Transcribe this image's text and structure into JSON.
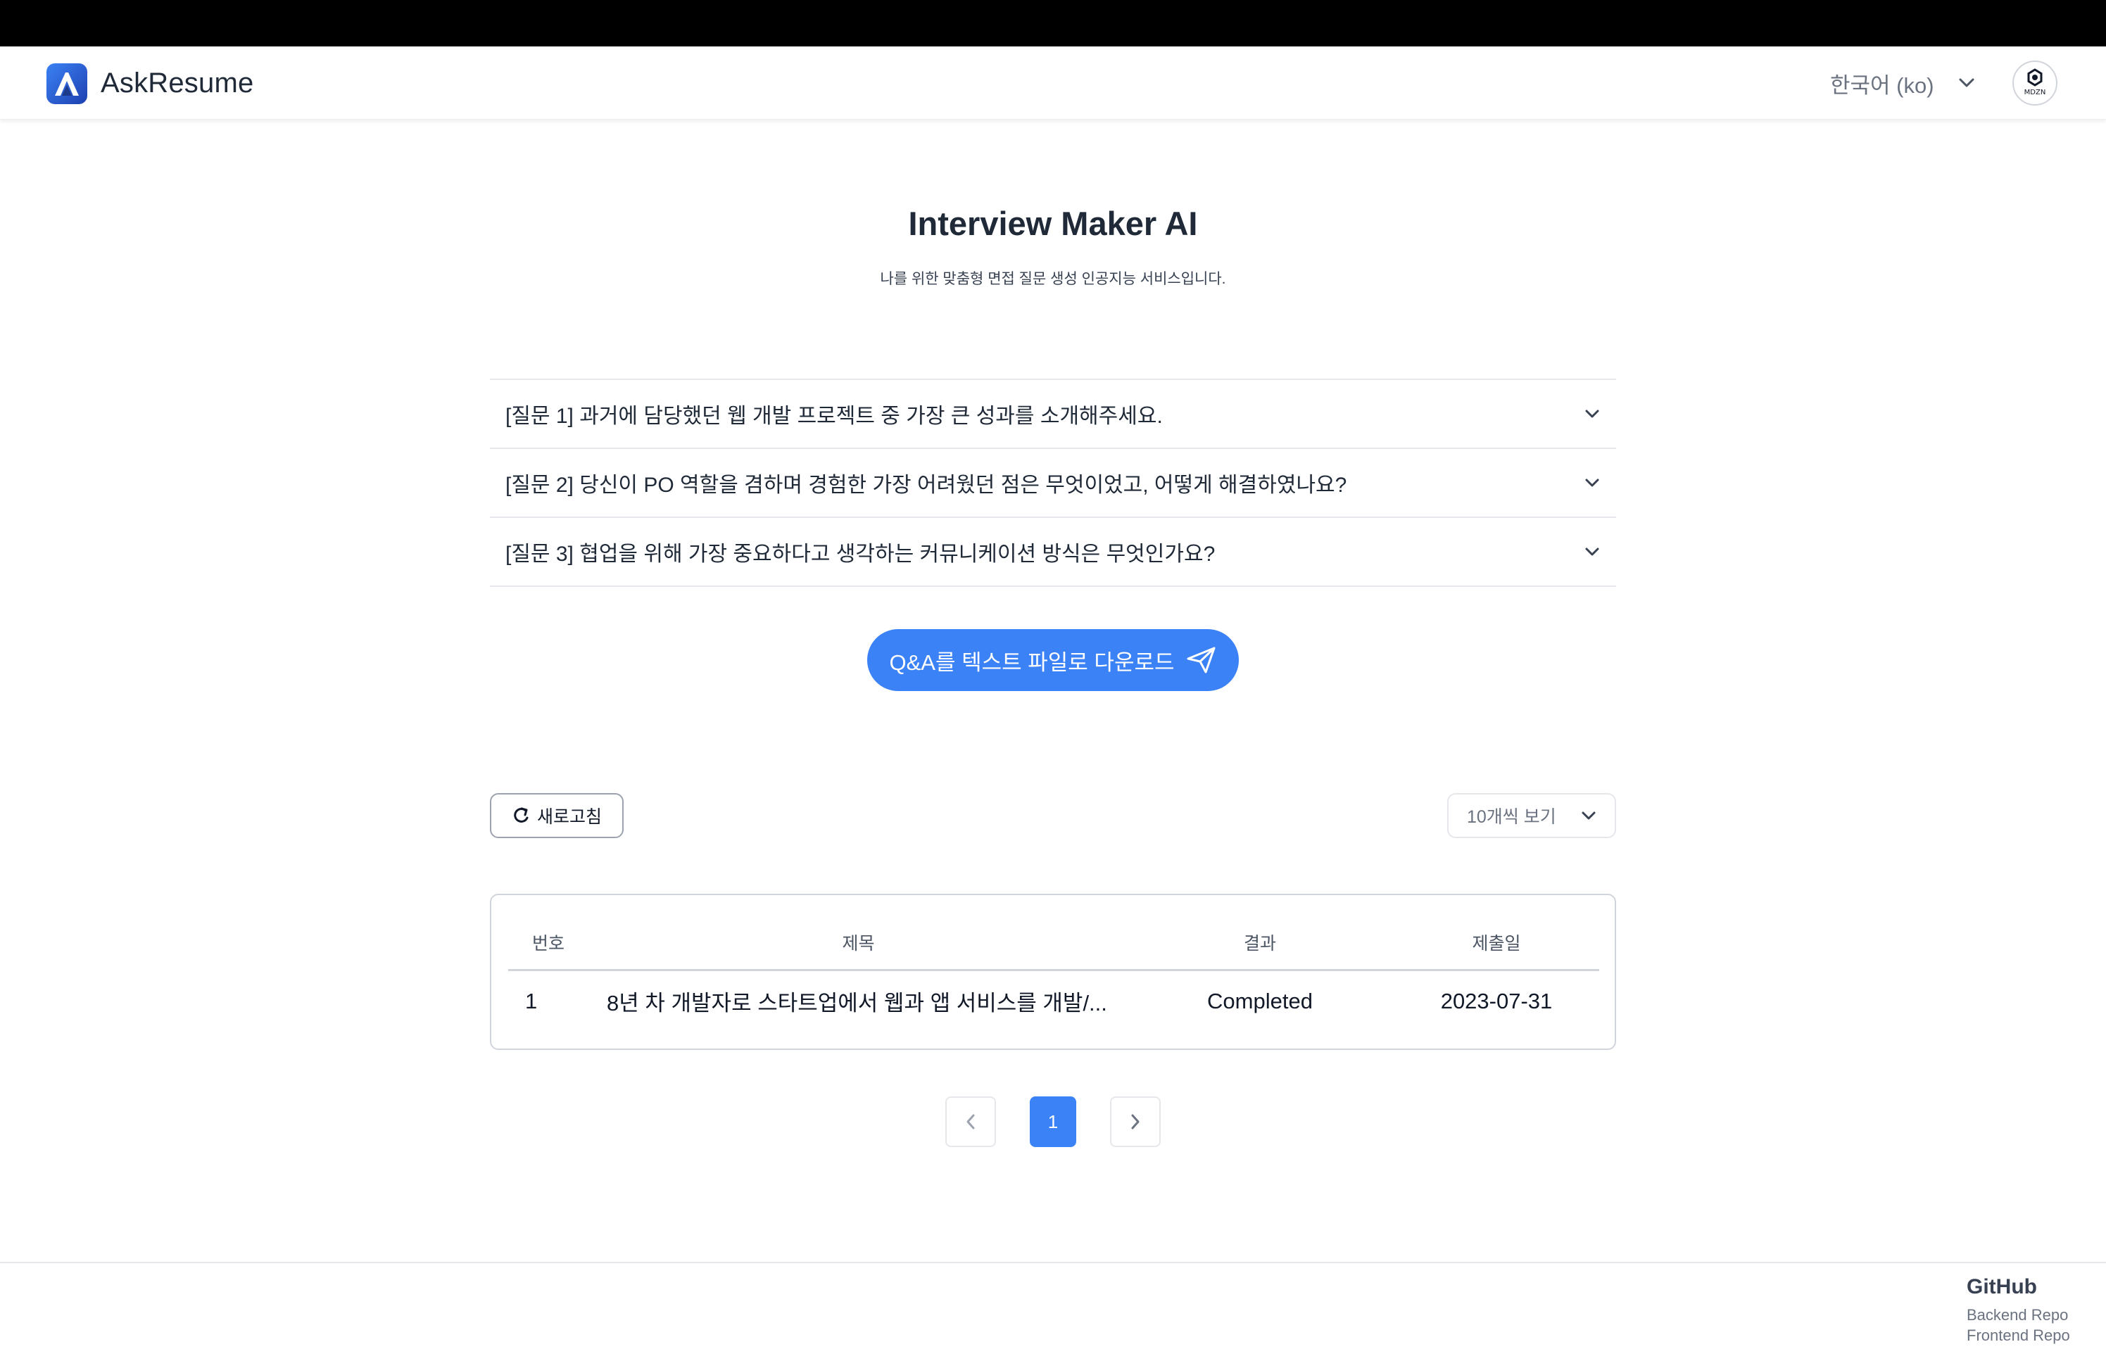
{
  "header": {
    "app_name": "AskResume",
    "language_label": "한국어 (ko)",
    "avatar_text": "MDZN",
    "brand_color": "#3b82f6"
  },
  "main": {
    "title": "Interview Maker AI",
    "subtitle": "나를 위한 맞춤형 면접 질문 생성 인공지능 서비스입니다.",
    "questions": [
      {
        "label": "[질문 1] 과거에 담당했던 웹 개발 프로젝트 중 가장 큰 성과를 소개해주세요."
      },
      {
        "label": "[질문 2] 당신이 PO 역할을 겸하며 경험한 가장 어려웠던 점은 무엇이었고, 어떻게 해결하였나요?"
      },
      {
        "label": "[질문 3] 협업을 위해 가장 중요하다고 생각하는 커뮤니케이션 방식은 무엇인가요?"
      }
    ],
    "download_label": "Q&A를 텍스트 파일로 다운로드"
  },
  "list": {
    "refresh_label": "새로고침",
    "per_page_label": "10개씩 보기",
    "columns": {
      "number": "번호",
      "title": "제목",
      "result": "결과",
      "date": "제출일"
    },
    "rows": [
      {
        "number": "1",
        "title": "8년 차 개발자로 스타트업에서 웹과 앱 서비스를 개발/...",
        "result": "Completed",
        "date": "2023-07-31"
      }
    ]
  },
  "pagination": {
    "current_page": "1"
  },
  "footer": {
    "heading": "GitHub",
    "links": [
      "Backend Repo",
      "Frontend Repo"
    ]
  }
}
